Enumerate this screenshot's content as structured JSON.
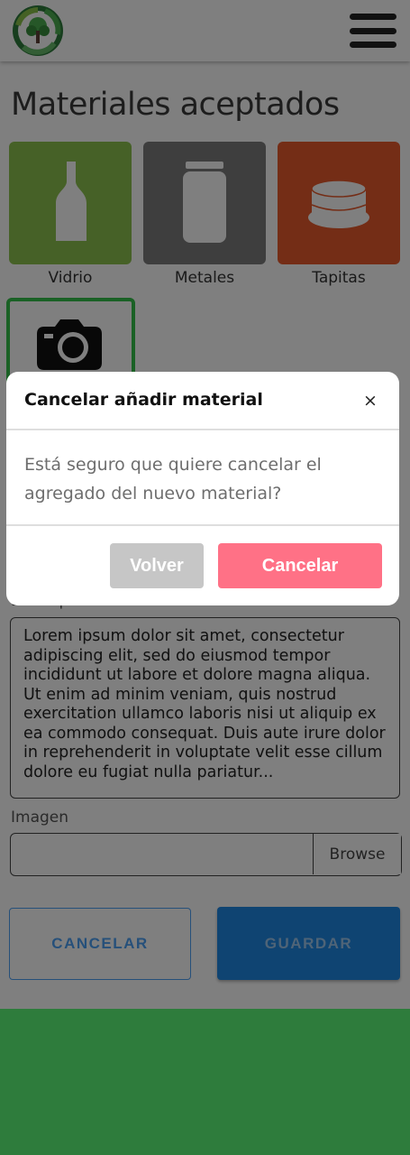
{
  "header": {
    "logo_icon": "recycle-tree-logo",
    "menu_icon": "hamburger-menu-icon"
  },
  "page_title": "Materiales aceptados",
  "materials": [
    {
      "label": "Vidrio",
      "color": "#8dc24f",
      "icon": "bottle-icon"
    },
    {
      "label": "Metales",
      "color": "#7d7d7d",
      "icon": "jar-icon"
    },
    {
      "label": "Tapitas",
      "color": "#e85a2c",
      "icon": "bottle-cap-icon"
    }
  ],
  "add_image_tile": {
    "icon": "camera-icon",
    "accent": "#34c24a"
  },
  "description": {
    "label": "Descripción",
    "value": "Lorem ipsum dolor sit amet, consectetur adipiscing elit, sed do eiusmod tempor incididunt ut labore et dolore magna aliqua. Ut enim ad minim veniam, quis nostrud exercitation ullamco laboris nisi ut aliquip ex ea commodo consequat. Duis aute irure dolor in reprehenderit in voluptate velit esse cillum dolore eu fugiat nulla pariatur..."
  },
  "image_field": {
    "label": "Imagen",
    "browse_label": "Browse"
  },
  "actions": {
    "cancel_label": "CANCELAR",
    "save_label": "GUARDAR"
  },
  "modal": {
    "title": "Cancelar añadir material",
    "close_symbol": "×",
    "body": "Está seguro que quiere cancelar el agregado del nuevo material?",
    "back_label": "Volver",
    "confirm_label": "Cancelar"
  },
  "colors": {
    "footer": "#2e7c3c",
    "primary": "#1e88e5",
    "danger": "#ff7186"
  }
}
